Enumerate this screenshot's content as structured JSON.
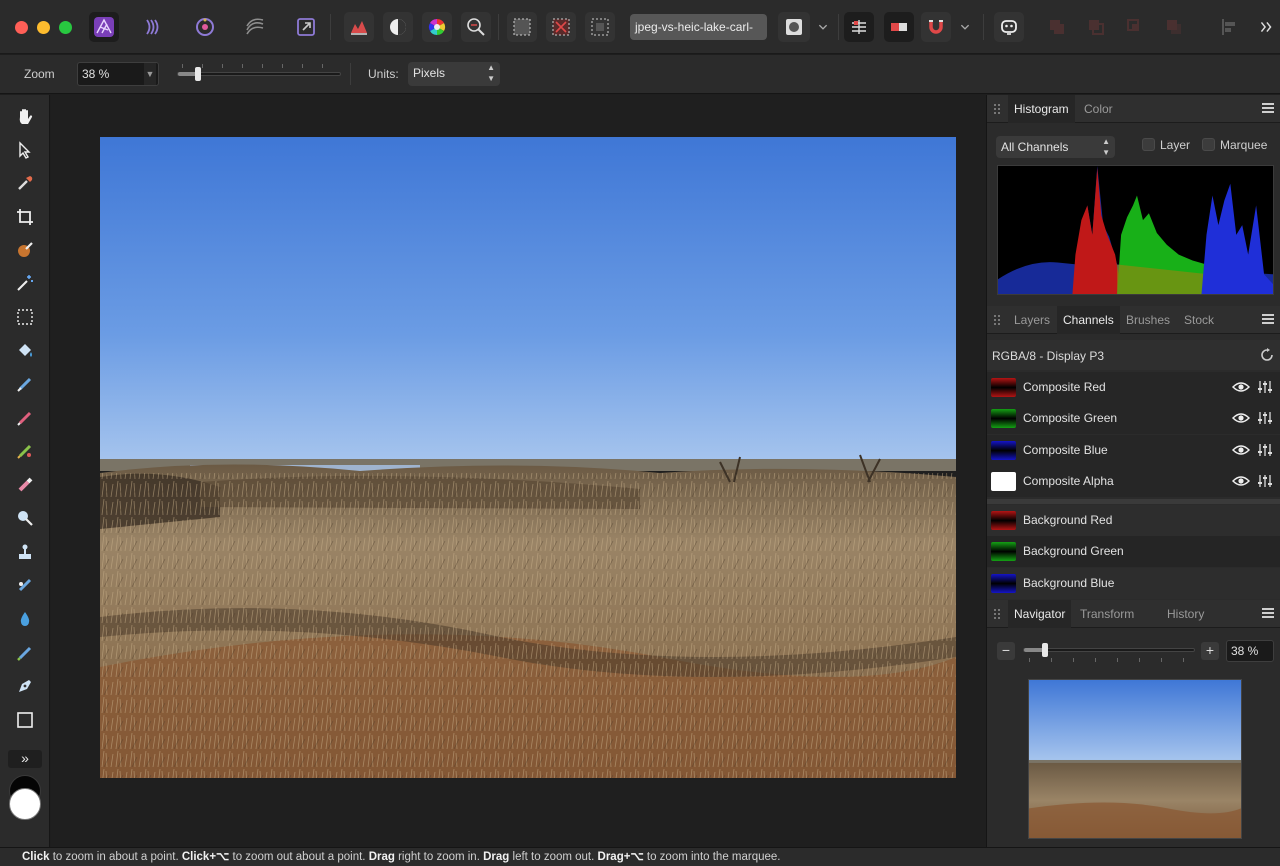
{
  "document": {
    "tab_title": "jpeg-vs-heic-lake-carl-"
  },
  "context_toolbar": {
    "zoom_label": "Zoom",
    "zoom_value": "38 %",
    "zoom_level_fraction": 0.12,
    "units_label": "Units:",
    "units_value": "Pixels"
  },
  "histogram_panel": {
    "tabs": [
      "Histogram",
      "Color"
    ],
    "channel_select": "All Channels",
    "layer_label": "Layer",
    "marquee_label": "Marquee"
  },
  "channels_panel": {
    "tabs": [
      "Layers",
      "Channels",
      "Brushes",
      "Stock"
    ],
    "format": "RGBA/8 - Display P3",
    "composite": [
      {
        "label": "Composite Red",
        "color": "#b41414"
      },
      {
        "label": "Composite Green",
        "color": "#14a014"
      },
      {
        "label": "Composite Blue",
        "color": "#1414c8"
      },
      {
        "label": "Composite Alpha",
        "color": "#ffffff"
      }
    ],
    "background": [
      {
        "label": "Background Red",
        "color": "#b41414"
      },
      {
        "label": "Background Green",
        "color": "#14a014"
      },
      {
        "label": "Background Blue",
        "color": "#1414c8"
      }
    ]
  },
  "navigator_panel": {
    "tabs": [
      "Navigator",
      "Transform",
      "History"
    ],
    "zoom_value": "38 %",
    "minus": "−",
    "plus": "+"
  },
  "tools": [
    "hand-tool",
    "move-tool",
    "color-picker-tool",
    "crop-tool",
    "selection-brush-tool",
    "flood-select-tool",
    "marquee-tool",
    "flood-fill-tool",
    "paint-brush-tool",
    "pixel-tool",
    "paint-mixer-tool",
    "erase-brush-tool",
    "dodge-tool",
    "clone-tool",
    "healing-brush-tool",
    "blur-tool",
    "inpainting-tool",
    "pen-tool",
    "rectangle-tool"
  ],
  "more_tools_glyph": "»",
  "status": {
    "parts": [
      {
        "b": "Click",
        "t": " to zoom in about a point. "
      },
      {
        "b": "Click+⌥",
        "t": " to zoom out about a point. "
      },
      {
        "b": "Drag",
        "t": " right to zoom in. "
      },
      {
        "b": "Drag",
        "t": " left to zoom out. "
      },
      {
        "b": "Drag+⌥",
        "t": " to zoom into the marquee."
      }
    ]
  }
}
